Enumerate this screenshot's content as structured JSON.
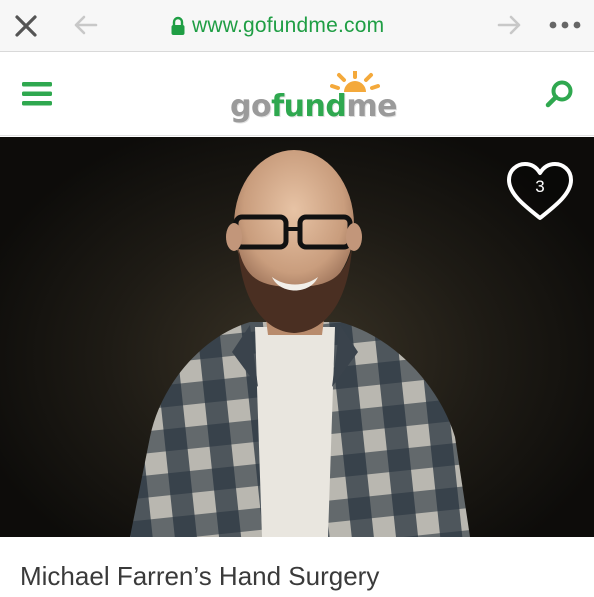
{
  "browser": {
    "url": "www.gofundme.com",
    "icons": [
      "close-icon",
      "back-icon",
      "lock-icon",
      "forward-icon",
      "more-icon"
    ],
    "url_color": "#1f9e44"
  },
  "header": {
    "logo": "gofundme",
    "logo_parts": [
      "go",
      "fund",
      "me"
    ],
    "icons": [
      "menu-icon",
      "search-icon"
    ],
    "accent_color": "#2fa84f"
  },
  "hero": {
    "favorite_count": "3",
    "icons": [
      "heart-icon"
    ]
  },
  "campaign": {
    "title": "Michael Farren’s Hand Surgery"
  }
}
